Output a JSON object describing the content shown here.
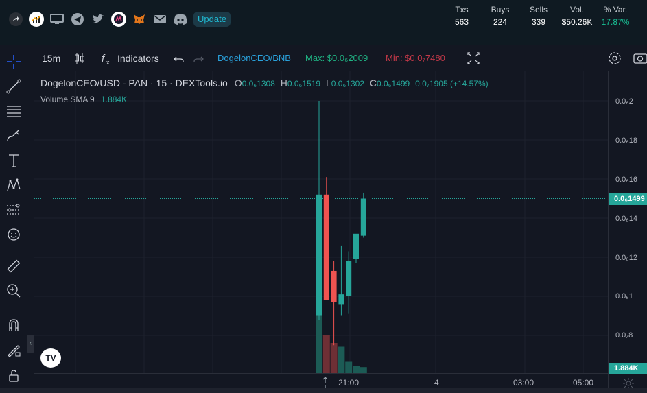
{
  "header": {
    "update_label": "Update",
    "icons": [
      "share-icon",
      "chart-app-icon",
      "monitor-icon",
      "telegram-icon",
      "twitter-icon",
      "token-logo-icon",
      "metamask-icon",
      "mail-icon",
      "discord-icon"
    ]
  },
  "stats": [
    {
      "label": "Txs",
      "value": "563"
    },
    {
      "label": "Buys",
      "value": "224"
    },
    {
      "label": "Sells",
      "value": "339"
    },
    {
      "label": "Vol.",
      "value": "$50.26K"
    },
    {
      "label": "% Var.",
      "value": "17.87%"
    }
  ],
  "toolbar": {
    "interval": "15m",
    "indicators_label": "Indicators",
    "pair_link": "DogelonCEO/BNB",
    "max_label": "Max: $0.0₆2009",
    "min_label": "Min: $0.0₇7480"
  },
  "legend": {
    "symbol": "DogelonCEO/USD - PAN · 15 · DEXTools.io",
    "open_key": "O",
    "open_val": "0.0₆1308",
    "high_key": "H",
    "high_val": "0.0₆1519",
    "low_key": "L",
    "low_val": "0.0₆1302",
    "close_key": "C",
    "close_val": "0.0₆1499",
    "change": "0.0₇1905 (+14.57%)",
    "volume_label": "Volume SMA 9",
    "volume_val": "1.884K"
  },
  "price_axis": {
    "labels": [
      "0.0₆2",
      "0.0₆18",
      "0.0₆16",
      "0.0₆14",
      "0.0₆12",
      "0.0₆1",
      "0.0₇8"
    ],
    "current_price": "0.0₆1499",
    "volume_tag": "1.884K"
  },
  "time_axis": {
    "labels": [
      "21:00",
      "4",
      "03:00",
      "05:00"
    ]
  },
  "colors": {
    "up": "#26a69a",
    "down": "#ef5350",
    "background": "#131722",
    "accent": "#2aa1db"
  },
  "chart_data": {
    "type": "candlestick",
    "interval": "15m",
    "ylim": [
      6.8e-08,
      2.05e-07
    ],
    "candles": [
      {
        "o": 9e-08,
        "h": 2e-07,
        "l": 8.8e-08,
        "c": 1.52e-07
      },
      {
        "o": 1.52e-07,
        "h": 1.61e-07,
        "l": 1.04e-07,
        "c": 9.8e-08
      },
      {
        "o": 1.13e-07,
        "h": 1.18e-07,
        "l": 7.5e-08,
        "c": 9.7e-08
      },
      {
        "o": 9.6e-08,
        "h": 1.26e-07,
        "l": 9e-08,
        "c": 1.01e-07
      },
      {
        "o": 1e-07,
        "h": 1.23e-07,
        "l": 9.1e-08,
        "c": 1.18e-07
      },
      {
        "o": 1.19e-07,
        "h": 1.26e-07,
        "l": 1.17e-07,
        "c": 1.32e-07
      },
      {
        "o": 1.31e-07,
        "h": 1.53e-07,
        "l": 1.3e-07,
        "c": 1.5e-07
      }
    ],
    "volume": [
      1,
      0.5,
      0.4,
      0.35,
      0.15,
      0.1,
      0.08
    ]
  }
}
